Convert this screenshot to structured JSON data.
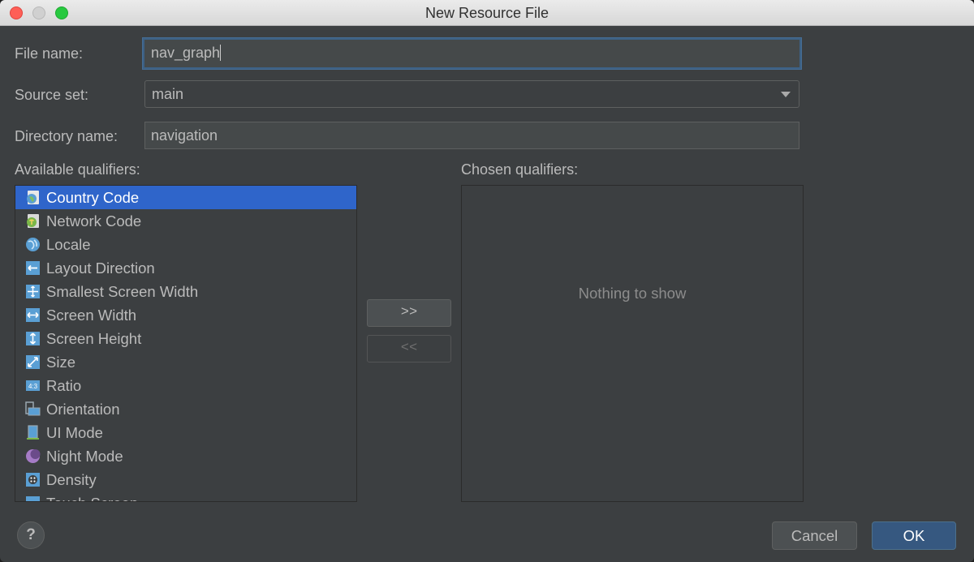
{
  "window": {
    "title": "New Resource File"
  },
  "form": {
    "file_name_label": "File name:",
    "file_name_value": "nav_graph",
    "source_set_label": "Source set:",
    "source_set_value": "main",
    "directory_name_label": "Directory name:",
    "directory_name_value": "navigation"
  },
  "available": {
    "label": "Available qualifiers:",
    "items": [
      {
        "label": "Country Code",
        "icon": "country-code-icon",
        "selected": true
      },
      {
        "label": "Network Code",
        "icon": "network-code-icon"
      },
      {
        "label": "Locale",
        "icon": "globe-icon"
      },
      {
        "label": "Layout Direction",
        "icon": "layout-direction-icon"
      },
      {
        "label": "Smallest Screen Width",
        "icon": "smallest-width-icon"
      },
      {
        "label": "Screen Width",
        "icon": "screen-width-icon"
      },
      {
        "label": "Screen Height",
        "icon": "screen-height-icon"
      },
      {
        "label": "Size",
        "icon": "size-icon"
      },
      {
        "label": "Ratio",
        "icon": "ratio-icon"
      },
      {
        "label": "Orientation",
        "icon": "orientation-icon"
      },
      {
        "label": "UI Mode",
        "icon": "ui-mode-icon"
      },
      {
        "label": "Night Mode",
        "icon": "night-mode-icon"
      },
      {
        "label": "Density",
        "icon": "density-icon"
      },
      {
        "label": "Touch Screen",
        "icon": "touch-screen-icon"
      }
    ]
  },
  "chosen": {
    "label": "Chosen qualifiers:",
    "empty_text": "Nothing to show"
  },
  "transfer": {
    "add_label": ">>",
    "remove_label": "<<"
  },
  "buttons": {
    "help_label": "?",
    "cancel_label": "Cancel",
    "ok_label": "OK"
  },
  "colors": {
    "background": "#3c3f41",
    "selection": "#2f65ca",
    "ok_button": "#365880"
  }
}
